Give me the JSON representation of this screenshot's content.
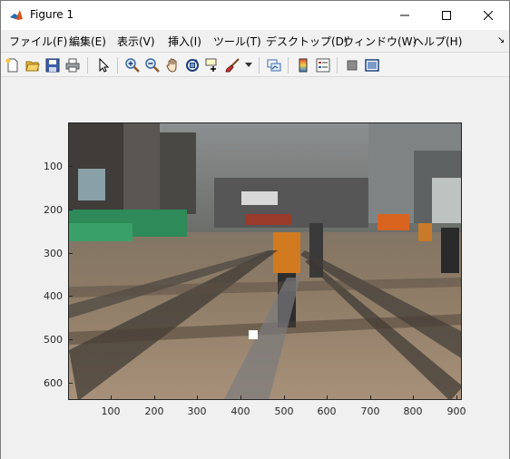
{
  "window": {
    "title": "Figure 1"
  },
  "menubar": {
    "items": [
      {
        "id": "file",
        "label": "ファイル(F)"
      },
      {
        "id": "edit",
        "label": "編集(E)"
      },
      {
        "id": "view",
        "label": "表示(V)"
      },
      {
        "id": "insert",
        "label": "挿入(I)"
      },
      {
        "id": "tools",
        "label": "ツール(T)"
      },
      {
        "id": "desktop",
        "label": "デスクトップ(D)"
      },
      {
        "id": "window",
        "label": "ウィンドウ(W)"
      },
      {
        "id": "help",
        "label": "ヘルプ(H)"
      }
    ]
  },
  "toolbar": {
    "icons": [
      "new-figure-icon",
      "open-file-icon",
      "save-icon",
      "print-icon",
      "pointer-icon",
      "zoom-in-icon",
      "zoom-out-icon",
      "pan-icon",
      "rotate-3d-icon",
      "data-cursor-icon",
      "brush-icon",
      "brush-dropdown-icon",
      "link-plot-icon",
      "colorbar-icon",
      "legend-icon",
      "hide-plot-tools-icon",
      "show-plot-tools-icon"
    ]
  },
  "axes": {
    "yticks": [
      "100",
      "200",
      "300",
      "400",
      "500",
      "600"
    ],
    "xticks": [
      "100",
      "200",
      "300",
      "400",
      "500",
      "600",
      "700",
      "800",
      "900"
    ],
    "ylim": [
      0,
      640
    ],
    "xlim": [
      0,
      910
    ]
  },
  "image": {
    "description_colors": {
      "sky": "#8a8e90",
      "track": "#9a8670",
      "orange": "#d27a20",
      "green": "#2e8a58"
    }
  }
}
